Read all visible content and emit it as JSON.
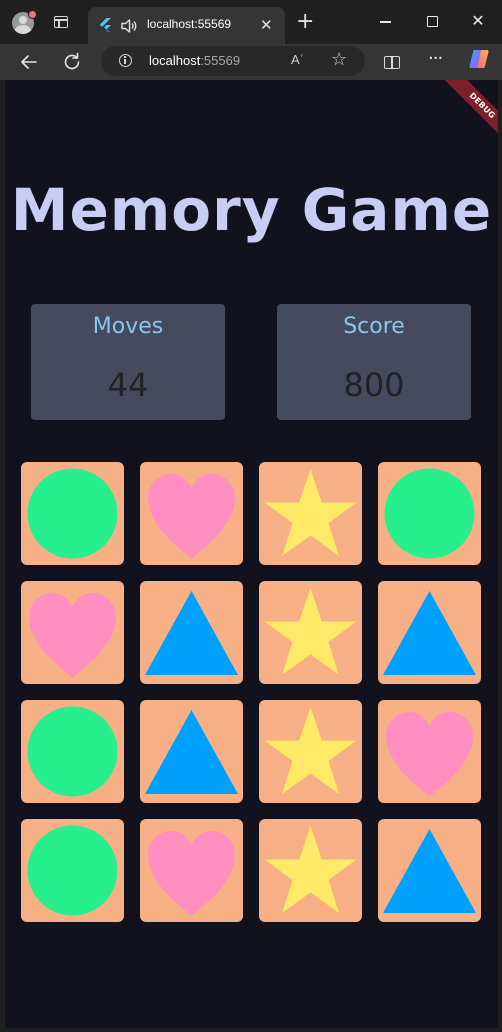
{
  "browser": {
    "tab_title": "localhost:55569",
    "close_glyph": "✕",
    "new_tab_glyph": "+",
    "url_host": "localhost",
    "url_port": ":55569",
    "read_aloud_label": "Aʾ",
    "icons": [
      "profile-icon",
      "tab-actions-icon",
      "flutter-favicon",
      "speaker-icon",
      "back-icon",
      "reload-icon",
      "info-icon",
      "read-aloud-icon",
      "favorite-icon",
      "split-screen-icon",
      "more-icon",
      "copilot-icon"
    ]
  },
  "app": {
    "debug_banner": "DEBUG",
    "title": "Memory Game",
    "stats": {
      "moves_label": "Moves",
      "moves_value": "44",
      "score_label": "Score",
      "score_value": "800"
    },
    "colors": {
      "background": "#11121d",
      "card": "#f7b085",
      "circle": "#27ef8e",
      "heart": "#fe8fc0",
      "star": "#ffe966",
      "triangle": "#00a1fd"
    },
    "grid": [
      [
        "circle",
        "heart",
        "star",
        "circle"
      ],
      [
        "heart",
        "triangle",
        "star",
        "triangle"
      ],
      [
        "circle",
        "triangle",
        "star",
        "heart"
      ],
      [
        "circle",
        "heart",
        "star",
        "triangle"
      ]
    ]
  }
}
